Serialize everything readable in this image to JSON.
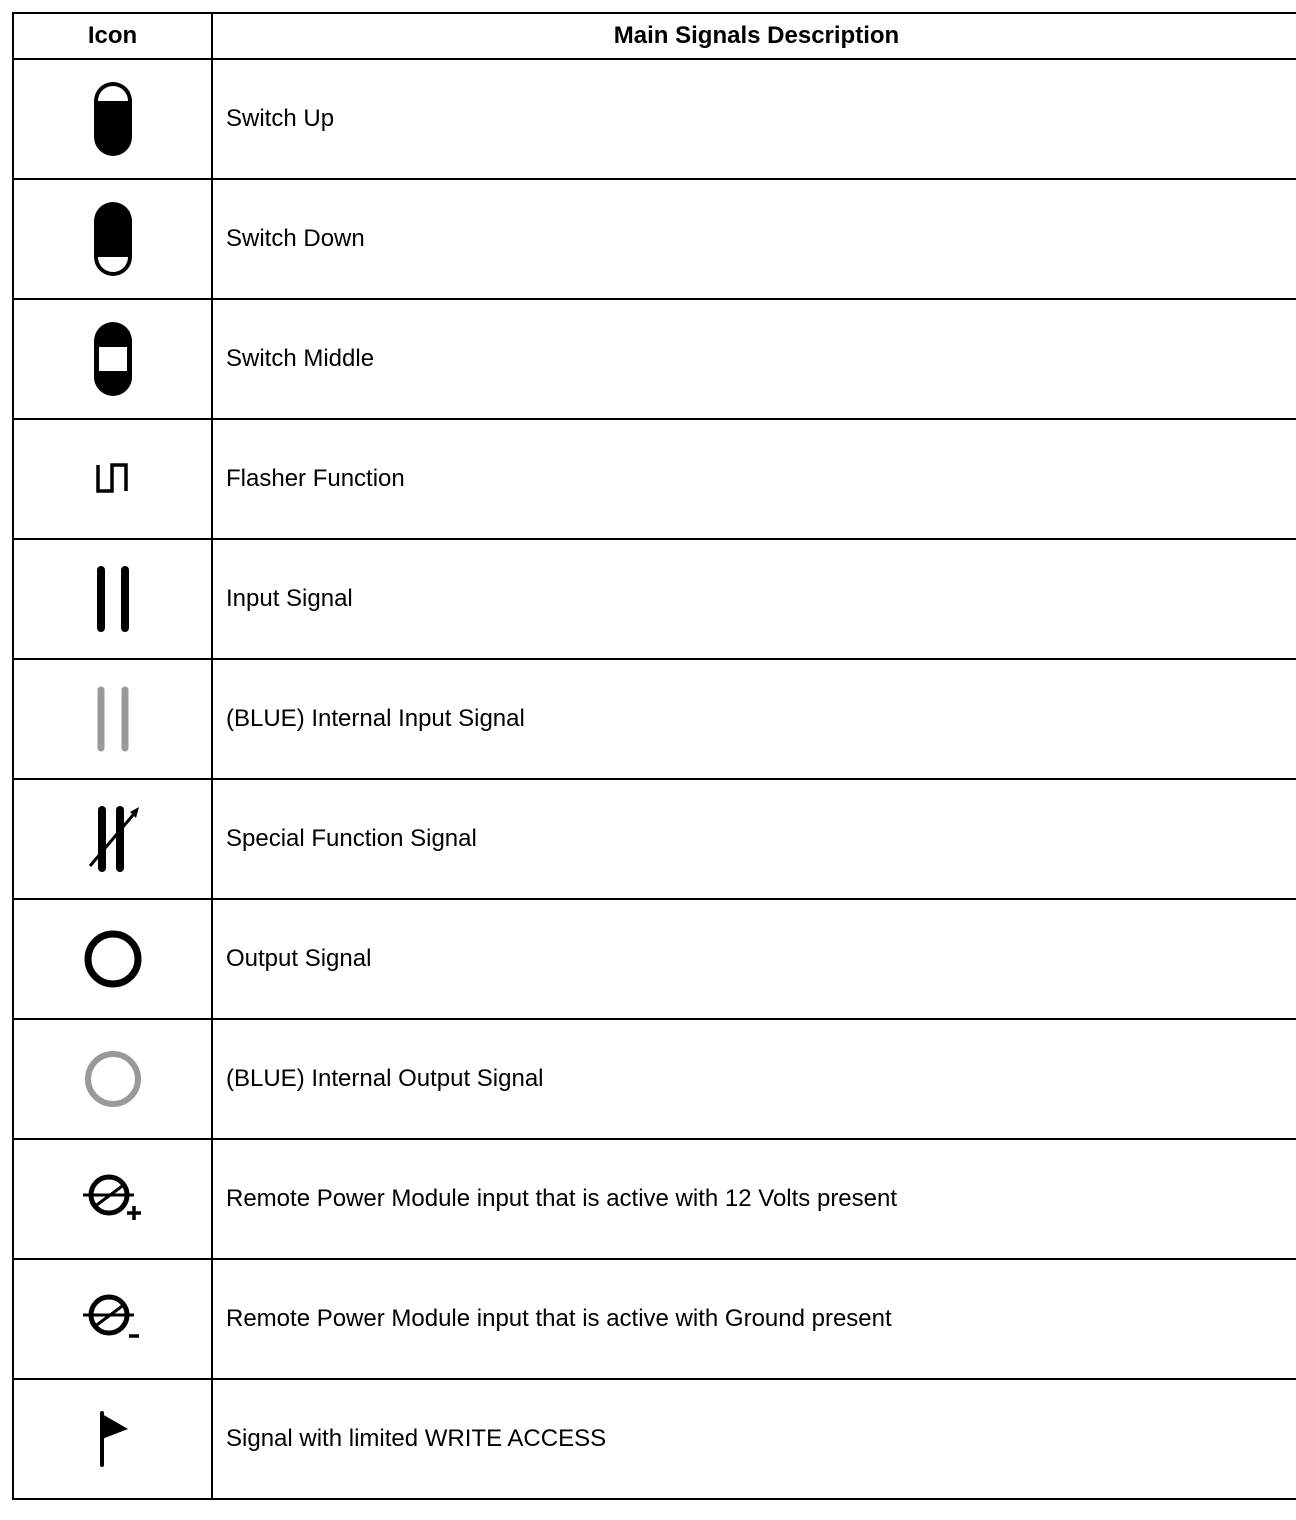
{
  "table": {
    "headers": {
      "icon": "Icon",
      "description": "Main Signals Description"
    },
    "rows": [
      {
        "icon": "switch-up-icon",
        "description": "Switch Up"
      },
      {
        "icon": "switch-down-icon",
        "description": "Switch Down"
      },
      {
        "icon": "switch-middle-icon",
        "description": "Switch Middle"
      },
      {
        "icon": "flasher-icon",
        "description": "Flasher Function"
      },
      {
        "icon": "input-signal-icon",
        "description": "Input Signal"
      },
      {
        "icon": "internal-input-signal-icon",
        "description": "(BLUE) Internal Input Signal"
      },
      {
        "icon": "special-function-signal-icon",
        "description": "Special Function Signal"
      },
      {
        "icon": "output-signal-icon",
        "description": "Output Signal"
      },
      {
        "icon": "internal-output-signal-icon",
        "description": "(BLUE) Internal Output Signal"
      },
      {
        "icon": "rpm-input-12v-icon",
        "description": "Remote Power Module input that is active with 12 Volts present"
      },
      {
        "icon": "rpm-input-ground-icon",
        "description": "Remote Power Module input that is active with Ground present"
      },
      {
        "icon": "write-access-flag-icon",
        "description": "Signal with limited WRITE ACCESS"
      }
    ]
  },
  "colors": {
    "border": "#000000",
    "icon_primary": "#000000",
    "icon_internal": "#999999"
  }
}
